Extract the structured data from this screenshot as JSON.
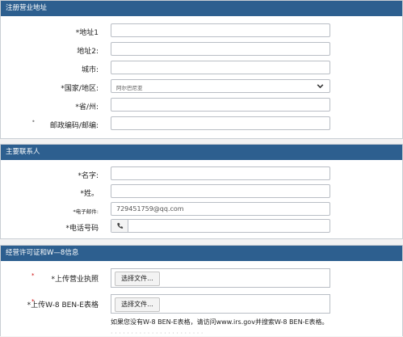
{
  "section_address": {
    "title": "注册营业地址",
    "fields": [
      {
        "label": "*地址1",
        "value": ""
      },
      {
        "label": "地址2:",
        "value": ""
      },
      {
        "label": "城市:",
        "value": ""
      },
      {
        "label": "*国家/地区:",
        "value": "阿尔巴尼亚"
      },
      {
        "label": "*省/州:",
        "value": ""
      },
      {
        "label": "邮政编码/邮编:",
        "value": ""
      }
    ]
  },
  "section_contact": {
    "title": "主要联系人",
    "fields": [
      {
        "label": "*名字:",
        "value": ""
      },
      {
        "label": "*姓。",
        "value": ""
      },
      {
        "label": "*电子邮件:",
        "value": "729451759@qq.com"
      },
      {
        "label": "*电话号码",
        "value": ""
      }
    ]
  },
  "section_license": {
    "title": "经营许可证和W—8信息",
    "uploads": [
      {
        "label": "*上传营业执照",
        "button": "选择文件..."
      },
      {
        "label": "*上传W-8 BEN-E表格",
        "button": "选择文件..."
      }
    ],
    "note": "如果您没有W-8 BEN-E表格，请访问www.irs.gov并搜索W-8 BEN-E表格。"
  },
  "icons": {
    "dropdown": "chevron-down-icon",
    "phone": "phone-icon"
  },
  "colors": {
    "header_bg": "#2d5f8f",
    "page_bg": "#f2f2f2"
  }
}
